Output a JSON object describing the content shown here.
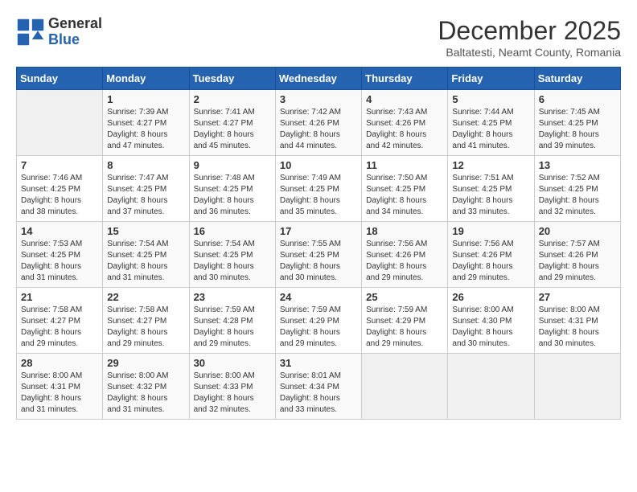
{
  "header": {
    "logo_text_general": "General",
    "logo_text_blue": "Blue",
    "month_title": "December 2025",
    "subtitle": "Baltatesti, Neamt County, Romania"
  },
  "calendar": {
    "days_of_week": [
      "Sunday",
      "Monday",
      "Tuesday",
      "Wednesday",
      "Thursday",
      "Friday",
      "Saturday"
    ],
    "weeks": [
      [
        {
          "day": "",
          "info": ""
        },
        {
          "day": "1",
          "info": "Sunrise: 7:39 AM\nSunset: 4:27 PM\nDaylight: 8 hours\nand 47 minutes."
        },
        {
          "day": "2",
          "info": "Sunrise: 7:41 AM\nSunset: 4:27 PM\nDaylight: 8 hours\nand 45 minutes."
        },
        {
          "day": "3",
          "info": "Sunrise: 7:42 AM\nSunset: 4:26 PM\nDaylight: 8 hours\nand 44 minutes."
        },
        {
          "day": "4",
          "info": "Sunrise: 7:43 AM\nSunset: 4:26 PM\nDaylight: 8 hours\nand 42 minutes."
        },
        {
          "day": "5",
          "info": "Sunrise: 7:44 AM\nSunset: 4:25 PM\nDaylight: 8 hours\nand 41 minutes."
        },
        {
          "day": "6",
          "info": "Sunrise: 7:45 AM\nSunset: 4:25 PM\nDaylight: 8 hours\nand 39 minutes."
        }
      ],
      [
        {
          "day": "7",
          "info": "Sunrise: 7:46 AM\nSunset: 4:25 PM\nDaylight: 8 hours\nand 38 minutes."
        },
        {
          "day": "8",
          "info": "Sunrise: 7:47 AM\nSunset: 4:25 PM\nDaylight: 8 hours\nand 37 minutes."
        },
        {
          "day": "9",
          "info": "Sunrise: 7:48 AM\nSunset: 4:25 PM\nDaylight: 8 hours\nand 36 minutes."
        },
        {
          "day": "10",
          "info": "Sunrise: 7:49 AM\nSunset: 4:25 PM\nDaylight: 8 hours\nand 35 minutes."
        },
        {
          "day": "11",
          "info": "Sunrise: 7:50 AM\nSunset: 4:25 PM\nDaylight: 8 hours\nand 34 minutes."
        },
        {
          "day": "12",
          "info": "Sunrise: 7:51 AM\nSunset: 4:25 PM\nDaylight: 8 hours\nand 33 minutes."
        },
        {
          "day": "13",
          "info": "Sunrise: 7:52 AM\nSunset: 4:25 PM\nDaylight: 8 hours\nand 32 minutes."
        }
      ],
      [
        {
          "day": "14",
          "info": "Sunrise: 7:53 AM\nSunset: 4:25 PM\nDaylight: 8 hours\nand 31 minutes."
        },
        {
          "day": "15",
          "info": "Sunrise: 7:54 AM\nSunset: 4:25 PM\nDaylight: 8 hours\nand 31 minutes."
        },
        {
          "day": "16",
          "info": "Sunrise: 7:54 AM\nSunset: 4:25 PM\nDaylight: 8 hours\nand 30 minutes."
        },
        {
          "day": "17",
          "info": "Sunrise: 7:55 AM\nSunset: 4:25 PM\nDaylight: 8 hours\nand 30 minutes."
        },
        {
          "day": "18",
          "info": "Sunrise: 7:56 AM\nSunset: 4:26 PM\nDaylight: 8 hours\nand 29 minutes."
        },
        {
          "day": "19",
          "info": "Sunrise: 7:56 AM\nSunset: 4:26 PM\nDaylight: 8 hours\nand 29 minutes."
        },
        {
          "day": "20",
          "info": "Sunrise: 7:57 AM\nSunset: 4:26 PM\nDaylight: 8 hours\nand 29 minutes."
        }
      ],
      [
        {
          "day": "21",
          "info": "Sunrise: 7:58 AM\nSunset: 4:27 PM\nDaylight: 8 hours\nand 29 minutes."
        },
        {
          "day": "22",
          "info": "Sunrise: 7:58 AM\nSunset: 4:27 PM\nDaylight: 8 hours\nand 29 minutes."
        },
        {
          "day": "23",
          "info": "Sunrise: 7:59 AM\nSunset: 4:28 PM\nDaylight: 8 hours\nand 29 minutes."
        },
        {
          "day": "24",
          "info": "Sunrise: 7:59 AM\nSunset: 4:29 PM\nDaylight: 8 hours\nand 29 minutes."
        },
        {
          "day": "25",
          "info": "Sunrise: 7:59 AM\nSunset: 4:29 PM\nDaylight: 8 hours\nand 29 minutes."
        },
        {
          "day": "26",
          "info": "Sunrise: 8:00 AM\nSunset: 4:30 PM\nDaylight: 8 hours\nand 30 minutes."
        },
        {
          "day": "27",
          "info": "Sunrise: 8:00 AM\nSunset: 4:31 PM\nDaylight: 8 hours\nand 30 minutes."
        }
      ],
      [
        {
          "day": "28",
          "info": "Sunrise: 8:00 AM\nSunset: 4:31 PM\nDaylight: 8 hours\nand 31 minutes."
        },
        {
          "day": "29",
          "info": "Sunrise: 8:00 AM\nSunset: 4:32 PM\nDaylight: 8 hours\nand 31 minutes."
        },
        {
          "day": "30",
          "info": "Sunrise: 8:00 AM\nSunset: 4:33 PM\nDaylight: 8 hours\nand 32 minutes."
        },
        {
          "day": "31",
          "info": "Sunrise: 8:01 AM\nSunset: 4:34 PM\nDaylight: 8 hours\nand 33 minutes."
        },
        {
          "day": "",
          "info": ""
        },
        {
          "day": "",
          "info": ""
        },
        {
          "day": "",
          "info": ""
        }
      ]
    ]
  }
}
